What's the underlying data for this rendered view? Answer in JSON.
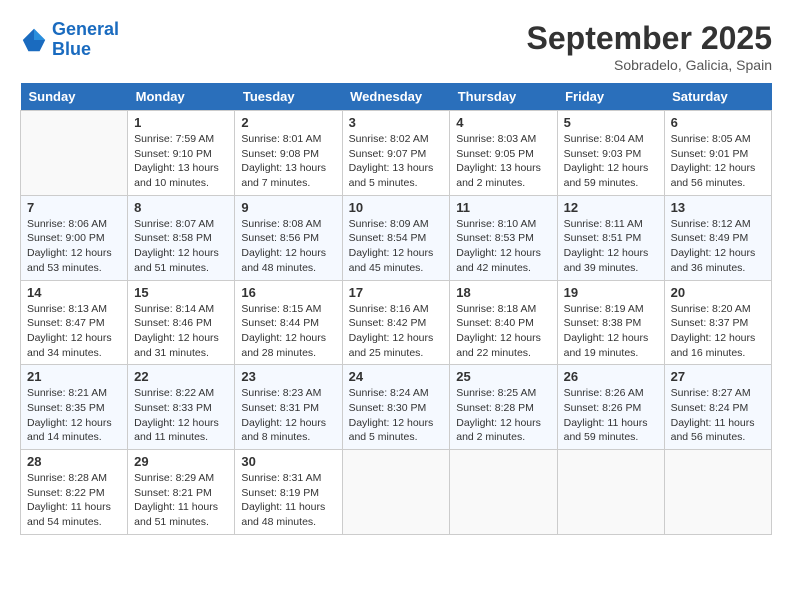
{
  "logo": {
    "line1": "General",
    "line2": "Blue"
  },
  "title": "September 2025",
  "location": "Sobradelo, Galicia, Spain",
  "weekdays": [
    "Sunday",
    "Monday",
    "Tuesday",
    "Wednesday",
    "Thursday",
    "Friday",
    "Saturday"
  ],
  "weeks": [
    [
      {
        "day": "",
        "sunrise": "",
        "sunset": "",
        "daylight": ""
      },
      {
        "day": "1",
        "sunrise": "Sunrise: 7:59 AM",
        "sunset": "Sunset: 9:10 PM",
        "daylight": "Daylight: 13 hours and 10 minutes."
      },
      {
        "day": "2",
        "sunrise": "Sunrise: 8:01 AM",
        "sunset": "Sunset: 9:08 PM",
        "daylight": "Daylight: 13 hours and 7 minutes."
      },
      {
        "day": "3",
        "sunrise": "Sunrise: 8:02 AM",
        "sunset": "Sunset: 9:07 PM",
        "daylight": "Daylight: 13 hours and 5 minutes."
      },
      {
        "day": "4",
        "sunrise": "Sunrise: 8:03 AM",
        "sunset": "Sunset: 9:05 PM",
        "daylight": "Daylight: 13 hours and 2 minutes."
      },
      {
        "day": "5",
        "sunrise": "Sunrise: 8:04 AM",
        "sunset": "Sunset: 9:03 PM",
        "daylight": "Daylight: 12 hours and 59 minutes."
      },
      {
        "day": "6",
        "sunrise": "Sunrise: 8:05 AM",
        "sunset": "Sunset: 9:01 PM",
        "daylight": "Daylight: 12 hours and 56 minutes."
      }
    ],
    [
      {
        "day": "7",
        "sunrise": "Sunrise: 8:06 AM",
        "sunset": "Sunset: 9:00 PM",
        "daylight": "Daylight: 12 hours and 53 minutes."
      },
      {
        "day": "8",
        "sunrise": "Sunrise: 8:07 AM",
        "sunset": "Sunset: 8:58 PM",
        "daylight": "Daylight: 12 hours and 51 minutes."
      },
      {
        "day": "9",
        "sunrise": "Sunrise: 8:08 AM",
        "sunset": "Sunset: 8:56 PM",
        "daylight": "Daylight: 12 hours and 48 minutes."
      },
      {
        "day": "10",
        "sunrise": "Sunrise: 8:09 AM",
        "sunset": "Sunset: 8:54 PM",
        "daylight": "Daylight: 12 hours and 45 minutes."
      },
      {
        "day": "11",
        "sunrise": "Sunrise: 8:10 AM",
        "sunset": "Sunset: 8:53 PM",
        "daylight": "Daylight: 12 hours and 42 minutes."
      },
      {
        "day": "12",
        "sunrise": "Sunrise: 8:11 AM",
        "sunset": "Sunset: 8:51 PM",
        "daylight": "Daylight: 12 hours and 39 minutes."
      },
      {
        "day": "13",
        "sunrise": "Sunrise: 8:12 AM",
        "sunset": "Sunset: 8:49 PM",
        "daylight": "Daylight: 12 hours and 36 minutes."
      }
    ],
    [
      {
        "day": "14",
        "sunrise": "Sunrise: 8:13 AM",
        "sunset": "Sunset: 8:47 PM",
        "daylight": "Daylight: 12 hours and 34 minutes."
      },
      {
        "day": "15",
        "sunrise": "Sunrise: 8:14 AM",
        "sunset": "Sunset: 8:46 PM",
        "daylight": "Daylight: 12 hours and 31 minutes."
      },
      {
        "day": "16",
        "sunrise": "Sunrise: 8:15 AM",
        "sunset": "Sunset: 8:44 PM",
        "daylight": "Daylight: 12 hours and 28 minutes."
      },
      {
        "day": "17",
        "sunrise": "Sunrise: 8:16 AM",
        "sunset": "Sunset: 8:42 PM",
        "daylight": "Daylight: 12 hours and 25 minutes."
      },
      {
        "day": "18",
        "sunrise": "Sunrise: 8:18 AM",
        "sunset": "Sunset: 8:40 PM",
        "daylight": "Daylight: 12 hours and 22 minutes."
      },
      {
        "day": "19",
        "sunrise": "Sunrise: 8:19 AM",
        "sunset": "Sunset: 8:38 PM",
        "daylight": "Daylight: 12 hours and 19 minutes."
      },
      {
        "day": "20",
        "sunrise": "Sunrise: 8:20 AM",
        "sunset": "Sunset: 8:37 PM",
        "daylight": "Daylight: 12 hours and 16 minutes."
      }
    ],
    [
      {
        "day": "21",
        "sunrise": "Sunrise: 8:21 AM",
        "sunset": "Sunset: 8:35 PM",
        "daylight": "Daylight: 12 hours and 14 minutes."
      },
      {
        "day": "22",
        "sunrise": "Sunrise: 8:22 AM",
        "sunset": "Sunset: 8:33 PM",
        "daylight": "Daylight: 12 hours and 11 minutes."
      },
      {
        "day": "23",
        "sunrise": "Sunrise: 8:23 AM",
        "sunset": "Sunset: 8:31 PM",
        "daylight": "Daylight: 12 hours and 8 minutes."
      },
      {
        "day": "24",
        "sunrise": "Sunrise: 8:24 AM",
        "sunset": "Sunset: 8:30 PM",
        "daylight": "Daylight: 12 hours and 5 minutes."
      },
      {
        "day": "25",
        "sunrise": "Sunrise: 8:25 AM",
        "sunset": "Sunset: 8:28 PM",
        "daylight": "Daylight: 12 hours and 2 minutes."
      },
      {
        "day": "26",
        "sunrise": "Sunrise: 8:26 AM",
        "sunset": "Sunset: 8:26 PM",
        "daylight": "Daylight: 11 hours and 59 minutes."
      },
      {
        "day": "27",
        "sunrise": "Sunrise: 8:27 AM",
        "sunset": "Sunset: 8:24 PM",
        "daylight": "Daylight: 11 hours and 56 minutes."
      }
    ],
    [
      {
        "day": "28",
        "sunrise": "Sunrise: 8:28 AM",
        "sunset": "Sunset: 8:22 PM",
        "daylight": "Daylight: 11 hours and 54 minutes."
      },
      {
        "day": "29",
        "sunrise": "Sunrise: 8:29 AM",
        "sunset": "Sunset: 8:21 PM",
        "daylight": "Daylight: 11 hours and 51 minutes."
      },
      {
        "day": "30",
        "sunrise": "Sunrise: 8:31 AM",
        "sunset": "Sunset: 8:19 PM",
        "daylight": "Daylight: 11 hours and 48 minutes."
      },
      {
        "day": "",
        "sunrise": "",
        "sunset": "",
        "daylight": ""
      },
      {
        "day": "",
        "sunrise": "",
        "sunset": "",
        "daylight": ""
      },
      {
        "day": "",
        "sunrise": "",
        "sunset": "",
        "daylight": ""
      },
      {
        "day": "",
        "sunrise": "",
        "sunset": "",
        "daylight": ""
      }
    ]
  ]
}
